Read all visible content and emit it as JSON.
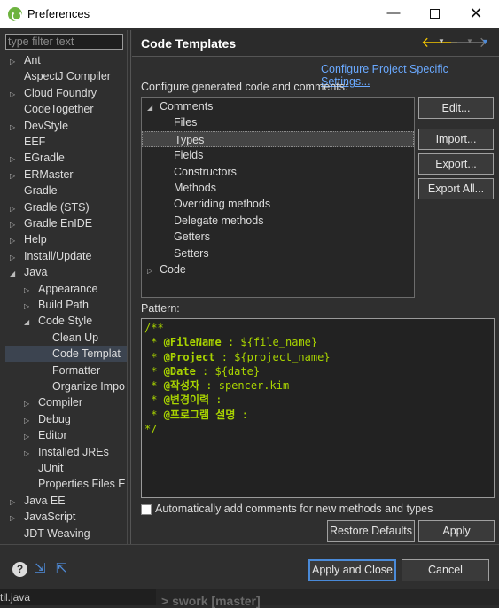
{
  "window": {
    "title": "Preferences",
    "minimize": "—",
    "close": "✕"
  },
  "filter": {
    "placeholder": "type filter text"
  },
  "tree": [
    {
      "label": "Ant",
      "toggle": "▷",
      "indent": 0
    },
    {
      "label": "AspectJ Compiler",
      "toggle": "",
      "indent": 0
    },
    {
      "label": "Cloud Foundry",
      "toggle": "▷",
      "indent": 0
    },
    {
      "label": "CodeTogether",
      "toggle": "",
      "indent": 0
    },
    {
      "label": "DevStyle",
      "toggle": "▷",
      "indent": 0
    },
    {
      "label": "EEF",
      "toggle": "",
      "indent": 0
    },
    {
      "label": "EGradle",
      "toggle": "▷",
      "indent": 0
    },
    {
      "label": "ERMaster",
      "toggle": "▷",
      "indent": 0
    },
    {
      "label": "Gradle",
      "toggle": "",
      "indent": 0
    },
    {
      "label": "Gradle (STS)",
      "toggle": "▷",
      "indent": 0
    },
    {
      "label": "Gradle EnIDE",
      "toggle": "▷",
      "indent": 0
    },
    {
      "label": "Help",
      "toggle": "▷",
      "indent": 0
    },
    {
      "label": "Install/Update",
      "toggle": "▷",
      "indent": 0
    },
    {
      "label": "Java",
      "toggle": "◢",
      "indent": 0
    },
    {
      "label": "Appearance",
      "toggle": "▷",
      "indent": 1
    },
    {
      "label": "Build Path",
      "toggle": "▷",
      "indent": 1
    },
    {
      "label": "Code Style",
      "toggle": "◢",
      "indent": 1
    },
    {
      "label": "Clean Up",
      "toggle": "",
      "indent": 2
    },
    {
      "label": "Code Templat",
      "toggle": "",
      "indent": 2,
      "selected": true
    },
    {
      "label": "Formatter",
      "toggle": "",
      "indent": 2
    },
    {
      "label": "Organize Impo",
      "toggle": "",
      "indent": 2
    },
    {
      "label": "Compiler",
      "toggle": "▷",
      "indent": 1
    },
    {
      "label": "Debug",
      "toggle": "▷",
      "indent": 1
    },
    {
      "label": "Editor",
      "toggle": "▷",
      "indent": 1
    },
    {
      "label": "Installed JREs",
      "toggle": "▷",
      "indent": 1
    },
    {
      "label": "JUnit",
      "toggle": "",
      "indent": 1
    },
    {
      "label": "Properties Files E",
      "toggle": "",
      "indent": 1
    },
    {
      "label": "Java EE",
      "toggle": "▷",
      "indent": 0
    },
    {
      "label": "JavaScript",
      "toggle": "▷",
      "indent": 0
    },
    {
      "label": "JDT Weaving",
      "toggle": "",
      "indent": 0
    }
  ],
  "page": {
    "title": "Code Templates",
    "configure_link": "Configure Project Specific Settings...",
    "configure_label": "Configure generated code and comments:",
    "pattern_label": "Pattern:"
  },
  "code_tree": [
    {
      "label": "Comments",
      "toggle": "◢",
      "indent": 0
    },
    {
      "label": "Files",
      "toggle": "",
      "indent": 1
    },
    {
      "label": "Types",
      "toggle": "",
      "indent": 1,
      "selected": true
    },
    {
      "label": "Fields",
      "toggle": "",
      "indent": 1
    },
    {
      "label": "Constructors",
      "toggle": "",
      "indent": 1
    },
    {
      "label": "Methods",
      "toggle": "",
      "indent": 1
    },
    {
      "label": "Overriding methods",
      "toggle": "",
      "indent": 1
    },
    {
      "label": "Delegate methods",
      "toggle": "",
      "indent": 1
    },
    {
      "label": "Getters",
      "toggle": "",
      "indent": 1
    },
    {
      "label": "Setters",
      "toggle": "",
      "indent": 1
    },
    {
      "label": "Code",
      "toggle": "▷",
      "indent": 0
    }
  ],
  "buttons": {
    "edit": "Edit...",
    "import": "Import...",
    "export": "Export...",
    "export_all": "Export All...",
    "restore_defaults": "Restore Defaults",
    "apply": "Apply",
    "apply_and_close": "Apply and Close",
    "cancel": "Cancel"
  },
  "pattern": {
    "line1": "/**",
    "l2_star": " * ",
    "l2_tag": "@FileName",
    "l2_rest": " : ${file_name}",
    "l3_star": " * ",
    "l3_tag": "@Project",
    "l3_rest": " : ${project_name}",
    "l4_star": " * ",
    "l4_tag": "@Date",
    "l4_rest": " : ${date}",
    "l5_star": " * ",
    "l5_tag": "@작성자",
    "l5_rest": " : spencer.kim",
    "l6_star": " * ",
    "l6_tag": "@변경이력",
    "l6_rest": " :",
    "l7_star": " * ",
    "l7_tag": "@프로그램 설명",
    "l7_rest": " :",
    "line8": "*/"
  },
  "checkbox": {
    "label": "Automatically add comments for new methods and types",
    "checked": false
  },
  "taskbar": {
    "file": "til.java",
    "branch": "> swork [master]"
  },
  "colors": {
    "accent": "#4a8ad8",
    "link": "#6aa9ff",
    "code": "#a9d400",
    "back_arrow": "#f2c500"
  }
}
